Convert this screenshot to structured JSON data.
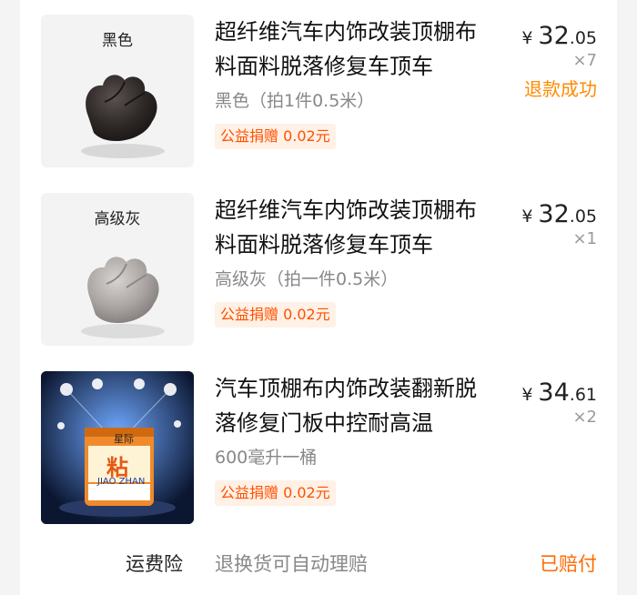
{
  "items": [
    {
      "thumb_label": "黑色",
      "title": "超纤维汽车内饰改装顶棚布料面料脱落修复车顶车",
      "spec": "黑色（拍1件0.5米）",
      "badge": "公益捐赠 0.02元",
      "currency": "¥",
      "price_int": "32",
      "price_dec": ".05",
      "qty": "×7",
      "status": "退款成功",
      "image": "black-fabric-swatch"
    },
    {
      "thumb_label": "高级灰",
      "title": "超纤维汽车内饰改装顶棚布料面料脱落修复车顶车",
      "spec": "高级灰（拍一件0.5米）",
      "badge": "公益捐赠 0.02元",
      "currency": "¥",
      "price_int": "32",
      "price_dec": ".05",
      "qty": "×1",
      "status": "",
      "image": "gray-fabric-swatch"
    },
    {
      "thumb_label": "",
      "title": "汽车顶棚布内饰改装翻新脱落修复门板中控耐高温",
      "spec": "600毫升一桶",
      "badge": "公益捐赠 0.02元",
      "currency": "¥",
      "price_int": "34",
      "price_dec": ".61",
      "qty": "×2",
      "status": "",
      "image": "glue-can-stage",
      "can_text": [
        "星际",
        "粘",
        "JIAO ZHAN"
      ]
    }
  ],
  "insurance": {
    "label": "运费险",
    "desc": "退换货可自动理赔",
    "status": "已赔付"
  },
  "colors": {
    "accent_orange": "#ff8a00",
    "badge_text": "#ff5000",
    "badge_bg": "#fff1e6"
  }
}
